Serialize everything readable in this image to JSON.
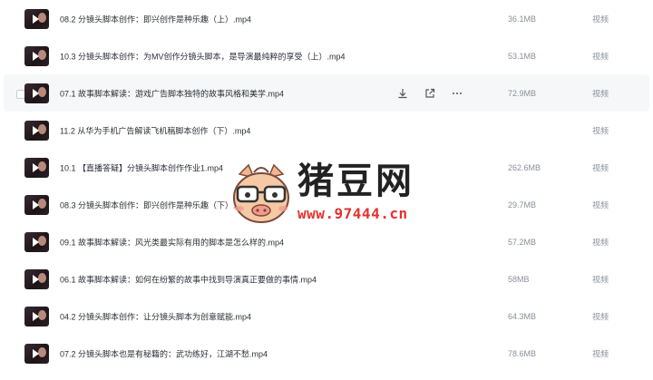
{
  "files": [
    {
      "name": "08.2 分镜头脚本创作：即兴创作是种乐趣（上）.mp4",
      "size": "36.1MB",
      "type": "视频"
    },
    {
      "name": "10.3 分镜头脚本创作：为MV创作分镜头脚本，是导演最纯粹的享受（上）.mp4",
      "size": "53.1MB",
      "type": "视频"
    },
    {
      "name": "07.1 故事脚本解读：游戏广告脚本独特的故事风格和美学.mp4",
      "size": "72.9MB",
      "type": "视频",
      "hover": true
    },
    {
      "name": "11.2 从华为手机广告解读飞机稿脚本创作（下）.mp4",
      "size": "",
      "type": "视频"
    },
    {
      "name": "10.1 【直播答疑】分镜头脚本创作作业1.mp4",
      "size": "262.6MB",
      "type": "视频"
    },
    {
      "name": "08.3 分镜头脚本创作：即兴创作是种乐趣（下）.mp4",
      "size": "29.7MB",
      "type": "视频"
    },
    {
      "name": "09.1 故事脚本解读：风光类最实际有用的脚本是怎么样的.mp4",
      "size": "57.2MB",
      "type": "视频"
    },
    {
      "name": "06.1 故事脚本解读：如何在纷繁的故事中找到导演真正要做的事情.mp4",
      "size": "58MB",
      "type": "视频"
    },
    {
      "name": "04.2 分镜头脚本创作：让分镜头脚本为创意赋能.mp4",
      "size": "64.3MB",
      "type": "视频"
    },
    {
      "name": "07.2 分镜头脚本也是有秘籍的：武功练好，江湖不愁.mp4",
      "size": "78.6MB",
      "type": "视频"
    }
  ],
  "hover_actions": {
    "download": "download-icon",
    "share": "share-icon",
    "more": "more-icon"
  },
  "watermark": {
    "title": "猪豆网",
    "url": "www.97444.cn"
  },
  "colors": {
    "accent_red": "#e3322f",
    "text": "#2b2f36",
    "muted": "#8a8f98",
    "hover_bg": "#f6f7f9"
  }
}
